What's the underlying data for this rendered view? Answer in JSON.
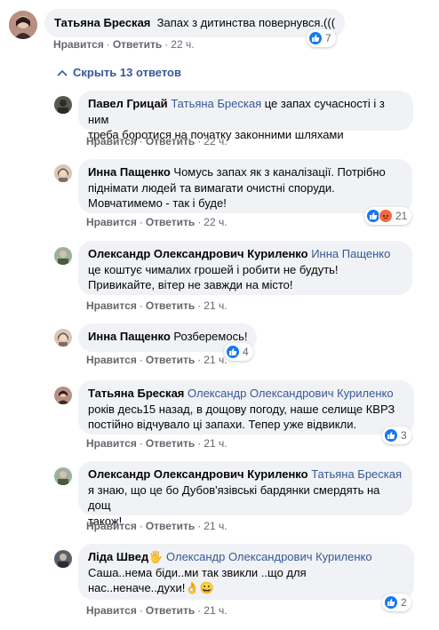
{
  "top_comment": {
    "author": "Татьяна Бреская",
    "text": "Запах з дитинства повернувся.(((",
    "like_label": "Нравится",
    "reply_label": "Ответить",
    "time": "22 ч.",
    "reactions_count": "7"
  },
  "hide_replies_label": "Скрыть 13 ответов",
  "replies": [
    {
      "author": "Павел Грицай",
      "mention": "Татьяна Бреская",
      "text_line1": " це запах сучасності і з ним",
      "text_line2": "треба боротися на початку законними шляхами",
      "like_label": "Нравится",
      "reply_label": "Ответить",
      "time": "22 ч."
    },
    {
      "author": "Инна Пащенко",
      "text_line1": " Чомусь запах як з каналізації. Потрібно",
      "text_line2": "піднімати людей та вимагати очистні споруди.",
      "text_line3": "Мовчатимемо - так і буде!",
      "like_label": "Нравится",
      "reply_label": "Ответить",
      "time": "22 ч.",
      "reactions_count": "21"
    },
    {
      "author": "Олександр Олександрович Куриленко",
      "mention": "Инна Пащенко",
      "text_line1": "це коштує чималих грошей і робити не будуть!",
      "text_line2": "Привикайте, вітер не завжди на місто!",
      "like_label": "Нравится",
      "reply_label": "Ответить",
      "time": "21 ч."
    },
    {
      "author": "Инна Пащенко",
      "text_line1": " Розберемось!",
      "like_label": "Нравится",
      "reply_label": "Ответить",
      "time": "21 ч.",
      "reactions_count": "4"
    },
    {
      "author": "Татьяна Бреская",
      "mention": "Олександр Олександрович Куриленко",
      "text_line1": "років десь15 назад, в дощову погоду, наше селище КВРЗ",
      "text_line2": "постійно відчувало ці запахи. Тепер уже відвикли.",
      "like_label": "Нравится",
      "reply_label": "Ответить",
      "time": "21 ч.",
      "reactions_count": "3"
    },
    {
      "author": "Олександр Олександрович Куриленко",
      "mention": "Татьяна Бреская",
      "text_line1": "я знаю, що це бо Дубов'язівські бардянки смердять на дощ",
      "text_line2": "також!",
      "like_label": "Нравится",
      "reply_label": "Ответить",
      "time": "21 ч."
    },
    {
      "author": "Ліда Швед",
      "author_suffix": "🖐",
      "mention": "Олександр Олександрович Куриленко",
      "text_line1": "Саша..нема біди..ми так звикли ..що для",
      "text_line2": "нас..неначе..духи!",
      "text_emoji": "👌😀",
      "like_label": "Нравится",
      "reply_label": "Ответить",
      "time": "21 ч.",
      "reactions_count": "2"
    }
  ],
  "colors": {
    "bubble": "#f0f2f5",
    "link": "#385898",
    "meta": "#65676b",
    "like": "#1877f2",
    "angry": "#f26a3c"
  }
}
